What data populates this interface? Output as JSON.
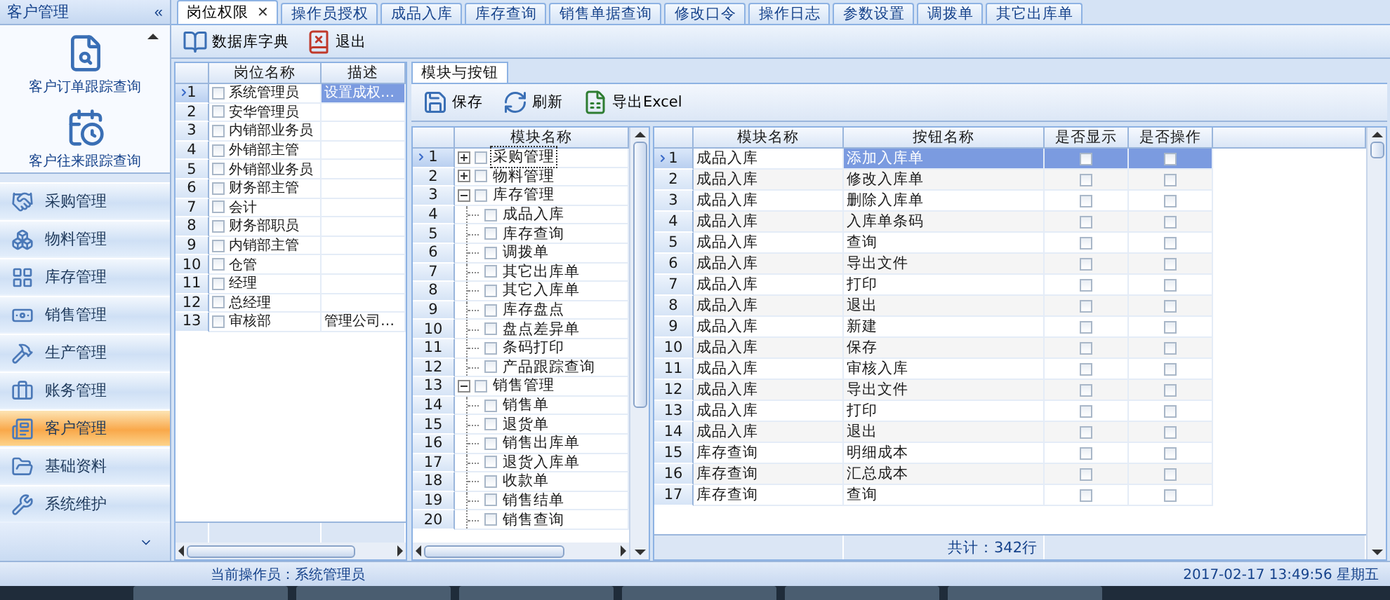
{
  "sidebar": {
    "title": "客户管理",
    "collapse": "«",
    "shortcuts": [
      {
        "label": "客户订单跟踪查询"
      },
      {
        "label": "客户往来跟踪查询"
      }
    ],
    "modules": [
      {
        "label": "采购管理",
        "selected": false
      },
      {
        "label": "物料管理",
        "selected": false
      },
      {
        "label": "库存管理",
        "selected": false
      },
      {
        "label": "销售管理",
        "selected": false
      },
      {
        "label": "生产管理",
        "selected": false
      },
      {
        "label": "账务管理",
        "selected": false
      },
      {
        "label": "客户管理",
        "selected": true
      },
      {
        "label": "基础资料",
        "selected": false
      },
      {
        "label": "系统维护",
        "selected": false
      }
    ]
  },
  "tabs": [
    {
      "label": "岗位权限",
      "selected": true,
      "close": "✕"
    },
    {
      "label": "操作员授权",
      "selected": false
    },
    {
      "label": "成品入库",
      "selected": false
    },
    {
      "label": "库存查询",
      "selected": false
    },
    {
      "label": "销售单据查询",
      "selected": false
    },
    {
      "label": "修改口令",
      "selected": false
    },
    {
      "label": "操作日志",
      "selected": false
    },
    {
      "label": "参数设置",
      "selected": false
    },
    {
      "label": "调拨单",
      "selected": false
    },
    {
      "label": "其它出库单",
      "selected": false
    }
  ],
  "toolbar": [
    {
      "label": "数据库字典"
    },
    {
      "label": "退出"
    }
  ],
  "positions": {
    "columns": [
      "岗位名称",
      "描述"
    ],
    "rows": [
      {
        "no": "1",
        "name": "系统管理员",
        "desc": "设置成权…",
        "checked": false,
        "selected": true
      },
      {
        "no": "2",
        "name": "安华管理员",
        "checked": false,
        "selected": false
      },
      {
        "no": "3",
        "name": "内销部业务员",
        "checked": false,
        "selected": false
      },
      {
        "no": "4",
        "name": "外销部主管",
        "checked": false,
        "selected": false
      },
      {
        "no": "5",
        "name": "外销部业务员",
        "checked": false,
        "selected": false
      },
      {
        "no": "6",
        "name": "财务部主管",
        "checked": false,
        "selected": false
      },
      {
        "no": "7",
        "name": "会计",
        "checked": false,
        "selected": false
      },
      {
        "no": "8",
        "name": "财务部职员",
        "checked": false,
        "selected": false
      },
      {
        "no": "9",
        "name": "内销部主管",
        "checked": false,
        "selected": false
      },
      {
        "no": "10",
        "name": "仓管",
        "checked": false,
        "selected": false
      },
      {
        "no": "11",
        "name": "经理",
        "checked": false,
        "selected": false
      },
      {
        "no": "12",
        "name": "总经理",
        "checked": false,
        "selected": false
      },
      {
        "no": "13",
        "name": "审核部",
        "desc": "管理公司…",
        "checked": false,
        "selected": false
      }
    ]
  },
  "panel": {
    "tab": "模块与按钮",
    "toolbar": [
      {
        "label": "保存"
      },
      {
        "label": "刷新"
      },
      {
        "label": "导出Excel"
      }
    ]
  },
  "tree": {
    "column": "模块名称",
    "rows": [
      {
        "no": "1",
        "label": "采购管理",
        "expanded": false,
        "checked": false,
        "selected": true
      },
      {
        "no": "2",
        "label": "物料管理",
        "expanded": false,
        "checked": false,
        "selected": false
      },
      {
        "no": "3",
        "label": "库存管理",
        "expanded": true,
        "checked": false,
        "selected": false,
        "children": [
          {
            "no": "4",
            "label": "成品入库",
            "checked": false
          },
          {
            "no": "5",
            "label": "库存查询",
            "checked": false
          },
          {
            "no": "6",
            "label": "调拨单",
            "checked": false
          },
          {
            "no": "7",
            "label": "其它出库单",
            "checked": false
          },
          {
            "no": "8",
            "label": "其它入库单",
            "checked": false
          },
          {
            "no": "9",
            "label": "库存盘点",
            "checked": false
          },
          {
            "no": "10",
            "label": "盘点差异单",
            "checked": false
          },
          {
            "no": "11",
            "label": "条码打印",
            "checked": false
          },
          {
            "no": "12",
            "label": "产品跟踪查询",
            "checked": false
          }
        ]
      },
      {
        "no": "13",
        "label": "销售管理",
        "expanded": true,
        "checked": false,
        "selected": false,
        "children": [
          {
            "no": "14",
            "label": "销售单",
            "checked": false
          },
          {
            "no": "15",
            "label": "退货单",
            "checked": false
          },
          {
            "no": "16",
            "label": "销售出库单",
            "checked": false
          },
          {
            "no": "17",
            "label": "退货入库单",
            "checked": false
          },
          {
            "no": "18",
            "label": "收款单",
            "checked": false
          },
          {
            "no": "19",
            "label": "销售结单",
            "checked": false
          },
          {
            "no": "20",
            "label": "销售查询",
            "checked": false
          }
        ]
      }
    ]
  },
  "buttons": {
    "columns": [
      "模块名称",
      "按钮名称",
      "是否显示",
      "是否操作"
    ],
    "footer": "共计：342行",
    "rows": [
      {
        "no": "1",
        "module": "成品入库",
        "button": "添加入库单",
        "show": false,
        "operate": false,
        "selected": true
      },
      {
        "no": "2",
        "module": "成品入库",
        "button": "修改入库单",
        "show": false,
        "operate": false,
        "selected": false
      },
      {
        "no": "3",
        "module": "成品入库",
        "button": "删除入库单",
        "show": false,
        "operate": false,
        "selected": false
      },
      {
        "no": "4",
        "module": "成品入库",
        "button": "入库单条码",
        "show": false,
        "operate": false,
        "selected": false
      },
      {
        "no": "5",
        "module": "成品入库",
        "button": "查询",
        "show": false,
        "operate": false,
        "selected": false
      },
      {
        "no": "6",
        "module": "成品入库",
        "button": "导出文件",
        "show": false,
        "operate": false,
        "selected": false
      },
      {
        "no": "7",
        "module": "成品入库",
        "button": "打印",
        "show": false,
        "operate": false,
        "selected": false
      },
      {
        "no": "8",
        "module": "成品入库",
        "button": "退出",
        "show": false,
        "operate": false,
        "selected": false
      },
      {
        "no": "9",
        "module": "成品入库",
        "button": "新建",
        "show": false,
        "operate": false,
        "selected": false
      },
      {
        "no": "10",
        "module": "成品入库",
        "button": "保存",
        "show": false,
        "operate": false,
        "selected": false
      },
      {
        "no": "11",
        "module": "成品入库",
        "button": "审核入库",
        "show": false,
        "operate": false,
        "selected": false
      },
      {
        "no": "12",
        "module": "成品入库",
        "button": "导出文件",
        "show": false,
        "operate": false,
        "selected": false
      },
      {
        "no": "13",
        "module": "成品入库",
        "button": "打印",
        "show": false,
        "operate": false,
        "selected": false
      },
      {
        "no": "14",
        "module": "成品入库",
        "button": "退出",
        "show": false,
        "operate": false,
        "selected": false
      },
      {
        "no": "15",
        "module": "库存查询",
        "button": "明细成本",
        "show": false,
        "operate": false,
        "selected": false
      },
      {
        "no": "16",
        "module": "库存查询",
        "button": "汇总成本",
        "show": false,
        "operate": false,
        "selected": false
      },
      {
        "no": "17",
        "module": "库存查询",
        "button": "查询",
        "show": false,
        "operate": false,
        "selected": false
      }
    ]
  },
  "status_bar": {
    "operator": "当前操作员：系统管理员",
    "datetime": "2017-02-17 13:49:56 星期五"
  }
}
